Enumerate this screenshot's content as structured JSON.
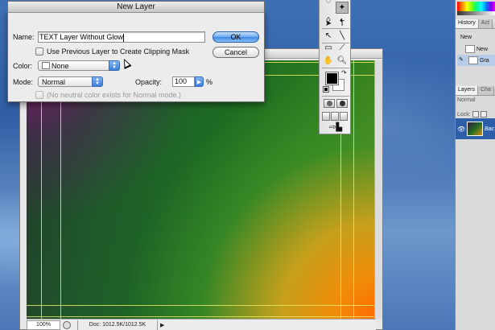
{
  "dialog": {
    "title": "New Layer",
    "name_label": "Name:",
    "name_value": "TEXT Layer Without Glow",
    "clipping_label": "Use Previous Layer to Create Clipping Mask",
    "color_label": "Color:",
    "color_value": "None",
    "mode_label": "Mode:",
    "mode_value": "Normal",
    "opacity_label": "Opacity:",
    "opacity_value": "100",
    "opacity_unit": "%",
    "neutral_label": "(No neutral color exists for Normal mode.)",
    "ok_label": "OK",
    "cancel_label": "Cancel"
  },
  "document": {
    "zoom": "100%",
    "doc_info": "Doc: 1012.5K/1012.5K"
  },
  "panels": {
    "history_tab": "History",
    "actions_tab": "Act",
    "history_item_1": "New",
    "history_item_2": "New",
    "history_item_3": "Gra",
    "layers_tab": "Layers",
    "channels_tab": "Cha",
    "layers_blend_mode": "Normal",
    "lock_label": "Lock:",
    "layer_name": "Bac"
  },
  "colors": {
    "foreground": "#000000",
    "background": "#ffffff",
    "accent": "#3d7fdb",
    "guide": "#e8e663"
  },
  "icons": {
    "toolbox": [
      "lasso-icon",
      "magic-wand-icon",
      "move-arrow-icon",
      "text-icon",
      "path-select-icon",
      "line-icon",
      "hand-icon",
      "zoom-icon",
      "eyedropper-icon",
      "notes-icon"
    ]
  }
}
